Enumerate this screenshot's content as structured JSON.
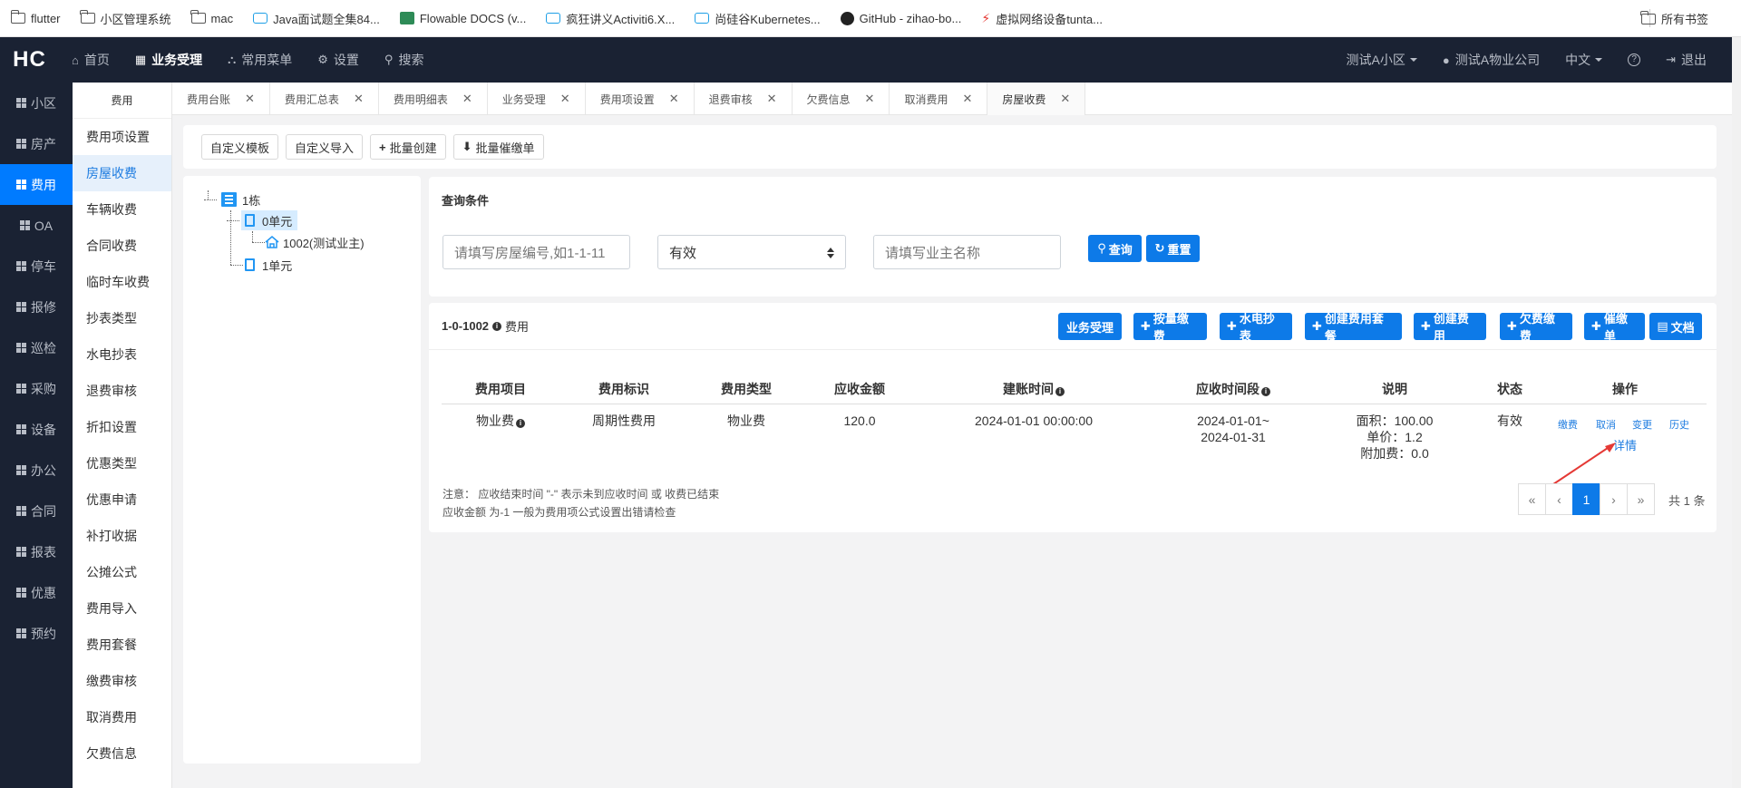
{
  "bookmarks": [
    {
      "label": "flutter",
      "icon": "folder-icon"
    },
    {
      "label": "小区管理系统",
      "icon": "folder-icon"
    },
    {
      "label": "mac",
      "icon": "folder-icon"
    },
    {
      "label": "Java面试题全集84...",
      "icon": "bilibili-icon"
    },
    {
      "label": "Flowable DOCS (v...",
      "icon": "flowable-icon"
    },
    {
      "label": "疯狂讲义Activiti6.X...",
      "icon": "bilibili-icon"
    },
    {
      "label": "尚硅谷Kubernetes...",
      "icon": "bilibili-icon"
    },
    {
      "label": "GitHub - zihao-bo...",
      "icon": "github-icon"
    },
    {
      "label": "虚拟网络设备tunta...",
      "icon": "bolt-icon"
    }
  ],
  "bookmarks_right": "所有书签",
  "nav": {
    "logo": "HC",
    "items": [
      {
        "label": "首页",
        "icon": "⌂"
      },
      {
        "label": "业务受理",
        "icon": "▦"
      },
      {
        "label": "常用菜单",
        "icon": "⛬"
      },
      {
        "label": "设置",
        "icon": "⚙"
      },
      {
        "label": "搜索",
        "icon": "⚲"
      }
    ],
    "community": "测试A小区",
    "company": "测试A物业公司",
    "language": "中文",
    "help": "?",
    "logout": "退出"
  },
  "sidebar": [
    "小区",
    "房产",
    "费用",
    "OA",
    "停车",
    "报修",
    "巡检",
    "采购",
    "设备",
    "办公",
    "合同",
    "报表",
    "优惠",
    "预约"
  ],
  "submenu": {
    "title": "费用",
    "items": [
      "费用项设置",
      "房屋收费",
      "车辆收费",
      "合同收费",
      "临时车收费",
      "抄表类型",
      "水电抄表",
      "退费审核",
      "折扣设置",
      "优惠类型",
      "优惠申请",
      "补打收据",
      "公摊公式",
      "费用导入",
      "费用套餐",
      "缴费审核",
      "取消费用",
      "欠费信息"
    ]
  },
  "tabs": [
    "费用台账",
    "费用汇总表",
    "费用明细表",
    "业务受理",
    "费用项设置",
    "退费审核",
    "欠费信息",
    "取消费用",
    "房屋收费"
  ],
  "toolbar": [
    "自定义模板",
    "自定义导入",
    "批量创建",
    "批量催缴单"
  ],
  "tree": {
    "building": "1栋",
    "unit0": "0单元",
    "room": "1002(测试业主)",
    "unit1": "1单元"
  },
  "query": {
    "title": "查询条件",
    "room_placeholder": "请填写房屋编号,如1-1-11",
    "status_value": "有效",
    "owner_placeholder": "请填写业主名称",
    "search_btn": "查询",
    "reset_btn": "重置"
  },
  "fee_panel": {
    "title_room": "1-0-1002",
    "title_suffix": "费用",
    "actions": [
      "业务受理",
      "按量缴费",
      "水电抄表",
      "创建费用套餐",
      "创建费用",
      "欠费缴费",
      "催缴单",
      "文档"
    ],
    "headers": [
      "费用项目",
      "费用标识",
      "费用类型",
      "应收金额",
      "建账时间",
      "应收时间段",
      "说明",
      "状态",
      "操作"
    ],
    "row": {
      "item": "物业费",
      "flag": "周期性费用",
      "type": "物业费",
      "amount": "120.0",
      "created": "2024-01-01 00:00:00",
      "period_start": "2024-01-01~",
      "period_end": "2024-01-31",
      "desc_area": "面积：100.00",
      "desc_price": "单价：1.2",
      "desc_extra": "附加费：0.0",
      "status": "有效",
      "ops": [
        "缴费",
        "取消",
        "变更",
        "历史"
      ],
      "detail": "详情"
    },
    "note1": "注意：  应收结束时间 \"-\" 表示未到应收时间 或 收费已结束",
    "note2": "应收金额 为-1 一般为费用项公式设置出错请检查",
    "pager": [
      "«",
      "‹",
      "1",
      "›",
      "»"
    ],
    "total": "共 1 条"
  },
  "colors": {
    "primary": "#0d7ae8",
    "nav_bg": "#1a2233",
    "annotation_arrow": "#e53935"
  }
}
